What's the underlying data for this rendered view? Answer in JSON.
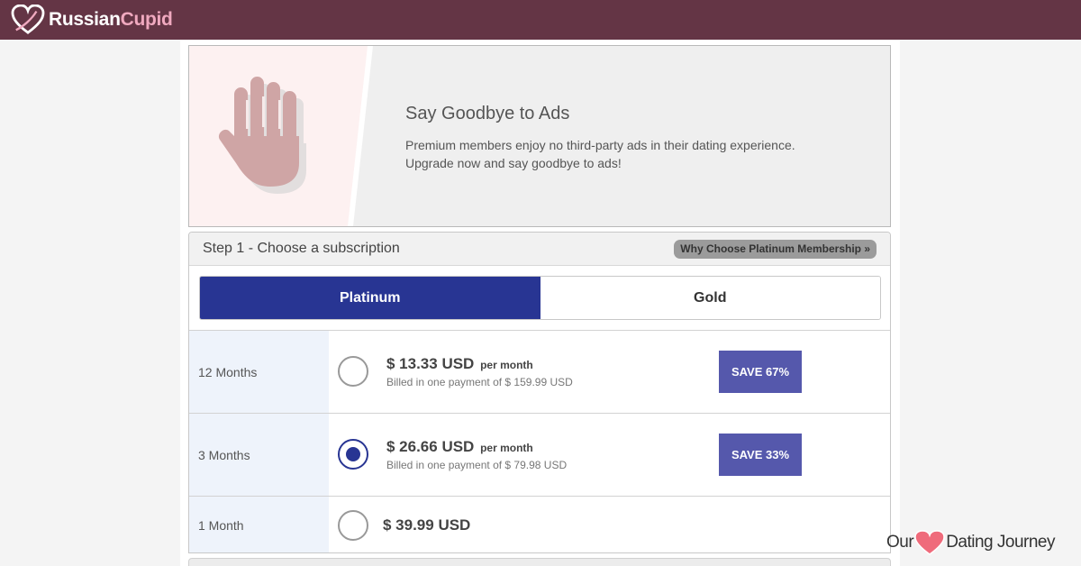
{
  "brand": {
    "name_part1": "Russian",
    "name_part2": "Cupid",
    "colors": {
      "header_bg": "#643545",
      "accent_pink": "#f0a9bf",
      "primary": "#283593",
      "save_badge": "#5558ac"
    }
  },
  "banner": {
    "icon": "hand-stop-icon",
    "title": "Say Goodbye to Ads",
    "line1": "Premium members enjoy no third-party ads in their dating experience.",
    "line2": "Upgrade now and say goodbye to ads!"
  },
  "step1": {
    "title": "Step 1 - Choose a subscription",
    "why_button": "Why Choose Platinum Membership »",
    "tabs": [
      {
        "label": "Platinum",
        "active": true
      },
      {
        "label": "Gold",
        "active": false
      }
    ],
    "plans": [
      {
        "duration": "12 Months",
        "price": "$ 13.33 USD",
        "per": "per month",
        "billed": "Billed in one payment of $ 159.99 USD",
        "save": "SAVE 67%",
        "selected": false
      },
      {
        "duration": "3 Months",
        "price": "$ 26.66 USD",
        "per": "per month",
        "billed": "Billed in one payment of $ 79.98 USD",
        "save": "SAVE 33%",
        "selected": true
      },
      {
        "duration": "1 Month",
        "price": "$ 39.99 USD",
        "selected": false
      }
    ]
  },
  "watermark": {
    "part1": "Our",
    "part2": "Dating Journey"
  }
}
